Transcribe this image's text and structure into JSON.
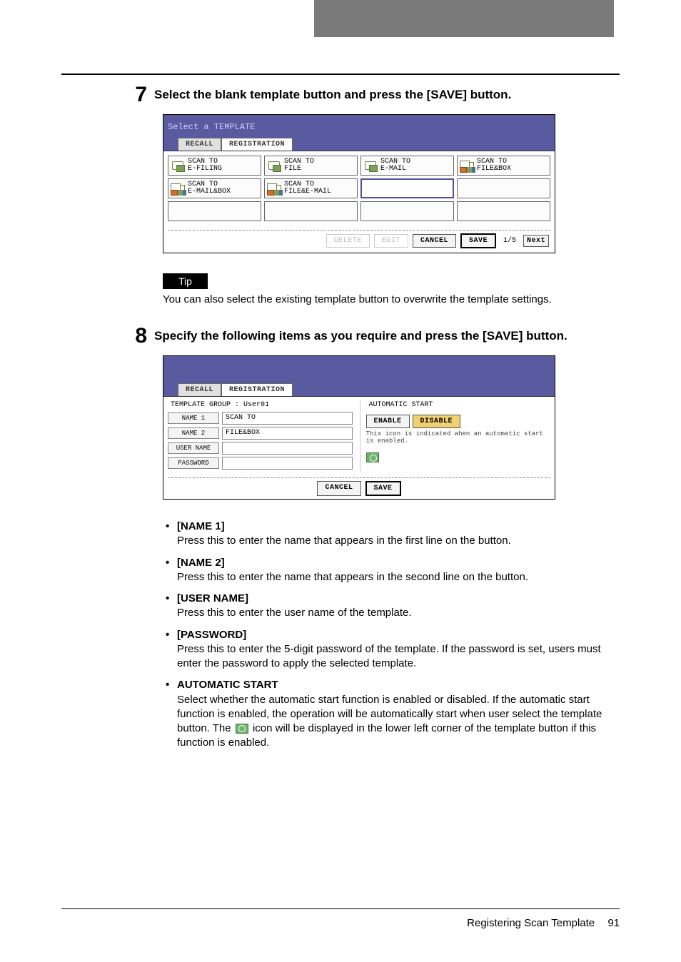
{
  "step7": {
    "num": "7",
    "instruction": "Select the blank template button and press the [SAVE] button."
  },
  "screenshot1": {
    "title": "Select a TEMPLATE",
    "tabs": {
      "recall": "RECALL",
      "registration": "REGISTRATION"
    },
    "templates": [
      {
        "l1": "SCAN TO",
        "l2": "E-FILING"
      },
      {
        "l1": "SCAN TO",
        "l2": "FILE"
      },
      {
        "l1": "SCAN TO",
        "l2": "E-MAIL"
      },
      {
        "l1": "SCAN TO",
        "l2": "FILE&BOX"
      },
      {
        "l1": "SCAN TO",
        "l2": "E-MAIL&BOX"
      },
      {
        "l1": "SCAN TO",
        "l2": "FILE&E-MAIL"
      }
    ],
    "buttons": {
      "delete": "DELETE",
      "edit": "EDIT",
      "cancel": "CANCEL",
      "save": "SAVE",
      "next": "Next"
    },
    "page": "1/5"
  },
  "tip": {
    "label": "Tip",
    "text": "You can also select the existing template button to overwrite the template settings."
  },
  "step8": {
    "num": "8",
    "instruction": "Specify the following items as you require and press the [SAVE] button."
  },
  "screenshot2": {
    "tabs": {
      "recall": "RECALL",
      "registration": "REGISTRATION"
    },
    "group_label": "TEMPLATE GROUP",
    "group_value": ": User01",
    "name1": {
      "label": "NAME 1",
      "value": "SCAN TO"
    },
    "name2": {
      "label": "NAME 2",
      "value": "FILE&BOX"
    },
    "username": {
      "label": "USER NAME",
      "value": ""
    },
    "password": {
      "label": "PASSWORD",
      "value": ""
    },
    "auto_label": "AUTOMATIC START",
    "enable": "ENABLE",
    "disable": "DISABLE",
    "hint": "This icon is indicated when an automatic start is enabled.",
    "buttons": {
      "cancel": "CANCEL",
      "save": "SAVE"
    }
  },
  "definitions": {
    "name1": {
      "title": "[NAME 1]",
      "desc": "Press this to enter the name that appears in the first line on the button."
    },
    "name2": {
      "title": "[NAME 2]",
      "desc": "Press this to enter the name that appears in the second line on the button."
    },
    "username": {
      "title": "[USER NAME]",
      "desc": "Press this to enter the user name of the template."
    },
    "password": {
      "title": "[PASSWORD]",
      "desc": "Press this to enter the 5-digit password of the template.  If the password is set, users must enter the password to apply the selected template."
    },
    "autostart": {
      "title": "AUTOMATIC START",
      "desc_a": "Select whether the automatic start function is enabled or disabled.  If the automatic start function is enabled, the operation will be automatically start when user select the template button.  The ",
      "desc_b": " icon will be displayed in the lower left corner of the template button if this function is enabled."
    }
  },
  "footer": {
    "text": "Registering Scan Template",
    "page": "91"
  }
}
